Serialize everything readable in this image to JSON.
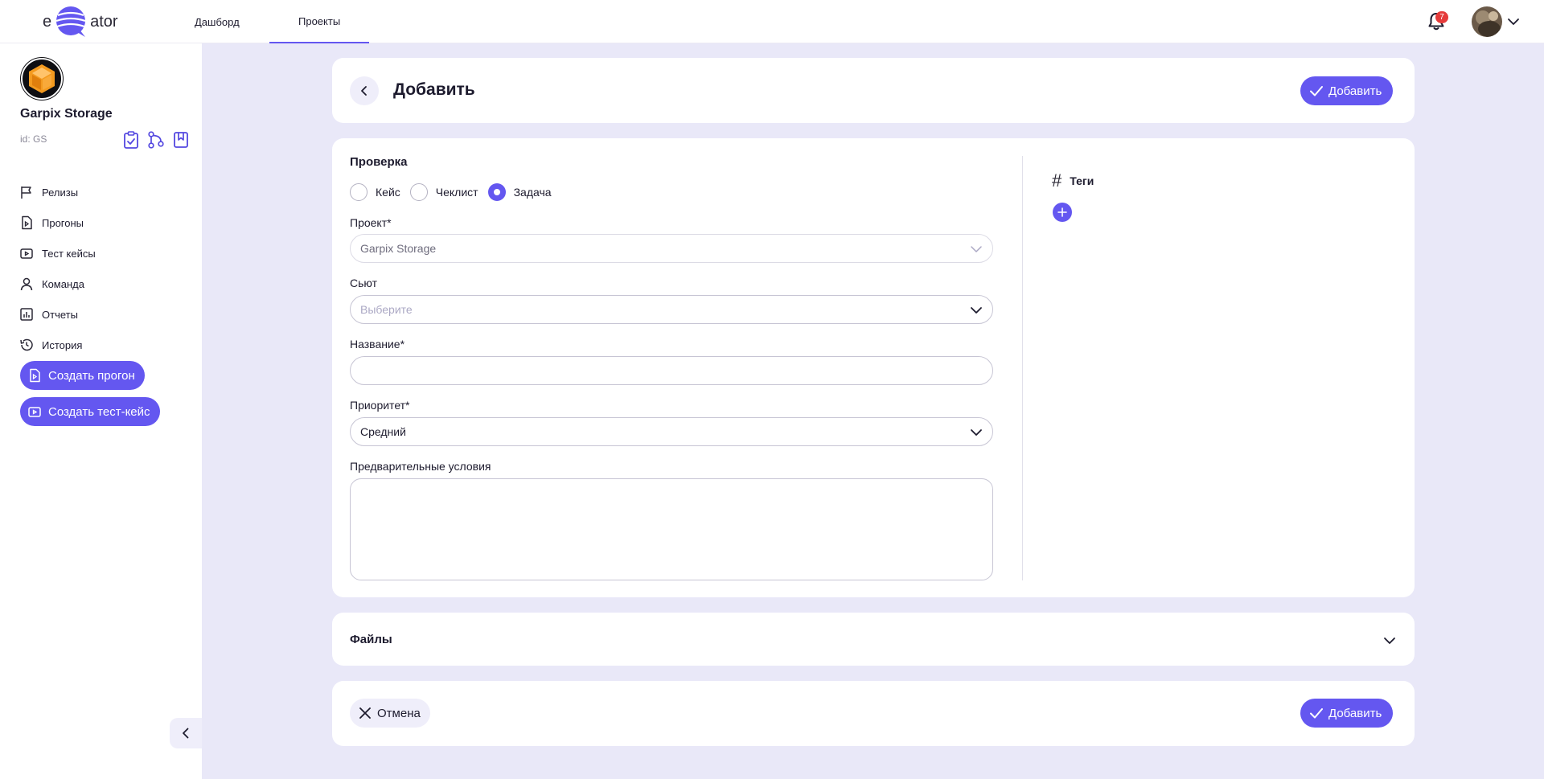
{
  "app": {
    "logo_left": "e",
    "logo_right": "ator",
    "accent_color": "#6457F0",
    "background_color": "#E9E8F8"
  },
  "topnav": {
    "tabs": [
      {
        "label": "Дашборд",
        "active": false
      },
      {
        "label": "Проекты",
        "active": true
      }
    ],
    "notifications_count": "7",
    "bell_icon": "bell-icon",
    "user_menu_icon": "chevron-down-icon"
  },
  "sidebar": {
    "project_name": "Garpix Storage",
    "project_id": "id: GS",
    "project_logo_icon": "cube-icon",
    "action_icons": [
      "clipboard-check-icon",
      "branch-icon",
      "bookmark-icon"
    ],
    "menu": [
      {
        "label": "Релизы",
        "icon": "flag-icon"
      },
      {
        "label": "Прогоны",
        "icon": "file-icon"
      },
      {
        "label": "Тест кейсы",
        "icon": "case-icon"
      },
      {
        "label": "Команда",
        "icon": "user-icon"
      },
      {
        "label": "Отчеты",
        "icon": "chart-icon"
      },
      {
        "label": "История",
        "icon": "history-icon"
      }
    ],
    "create_run_label": "Создать прогон",
    "create_case_label": "Создать тест-кейс",
    "collapse_icon": "chevron-left-icon"
  },
  "header": {
    "title": "Добавить",
    "add_label": "Добавить"
  },
  "form": {
    "section_title": "Проверка",
    "type_options": [
      {
        "label": "Кейс",
        "checked": false
      },
      {
        "label": "Чеклист",
        "checked": false
      },
      {
        "label": "Задача",
        "checked": true
      }
    ],
    "project_label": "Проект*",
    "project_value": "Garpix Storage",
    "suite_label": "Сьют",
    "suite_placeholder": "Выберите",
    "name_label": "Название*",
    "name_value": "",
    "priority_label": "Приоритет*",
    "priority_value": "Средний",
    "preconditions_label": "Предварительные условия",
    "preconditions_value": ""
  },
  "tags": {
    "symbol": "#",
    "label": "Теги",
    "add_icon": "plus-icon"
  },
  "files": {
    "title": "Файлы"
  },
  "footer": {
    "cancel_label": "Отмена",
    "add_label": "Добавить"
  }
}
